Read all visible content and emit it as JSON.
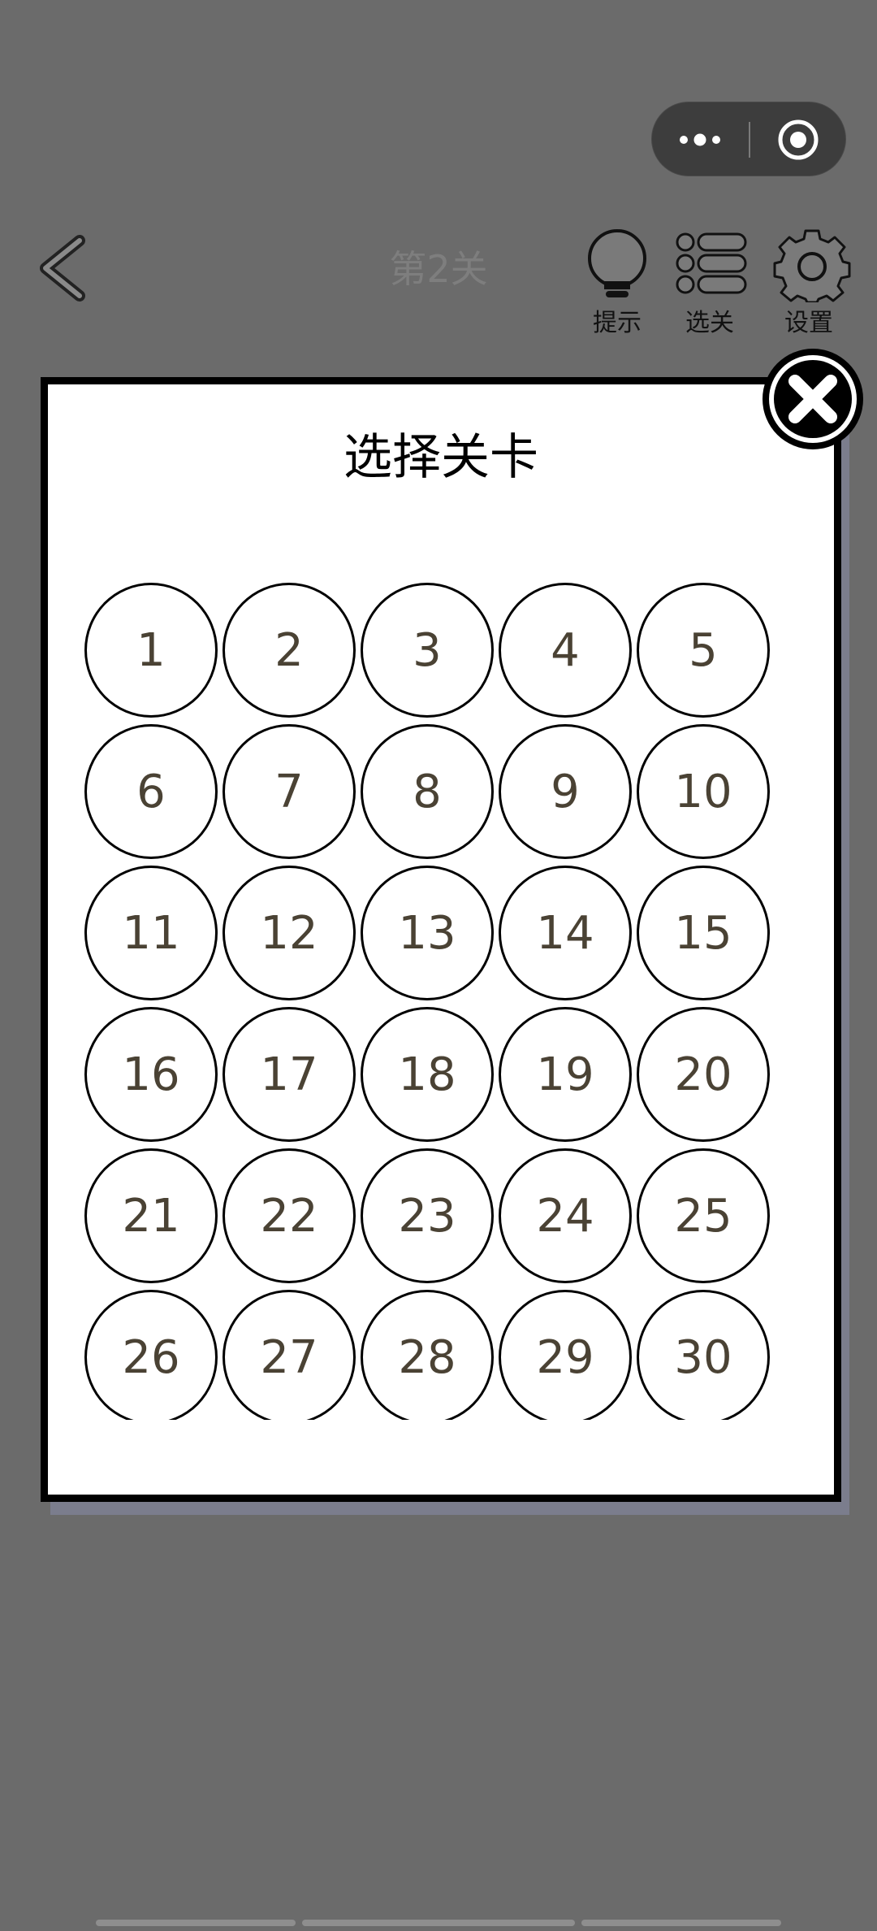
{
  "header": {
    "level_title": "第2关"
  },
  "toolbar": {
    "hint_label": "提示",
    "levels_label": "选关",
    "settings_label": "设置"
  },
  "modal": {
    "title": "选择关卡",
    "levels": [
      "1",
      "2",
      "3",
      "4",
      "5",
      "6",
      "7",
      "8",
      "9",
      "10",
      "11",
      "12",
      "13",
      "14",
      "15",
      "16",
      "17",
      "18",
      "19",
      "20",
      "21",
      "22",
      "23",
      "24",
      "25",
      "26",
      "27",
      "28",
      "29",
      "30"
    ]
  },
  "icons": {
    "capsule_more": "more-dots-icon",
    "capsule_close": "target-circle-icon",
    "back": "chevron-left-icon",
    "hint": "lightbulb-icon",
    "levels": "list-icon",
    "settings": "gear-icon",
    "close": "close-x-icon"
  },
  "colors": {
    "background": "#6b6b6b",
    "modal_bg": "#ffffff",
    "modal_border": "#000000",
    "level_number": "#4a4234",
    "title_dim": "#7e7e7e"
  }
}
